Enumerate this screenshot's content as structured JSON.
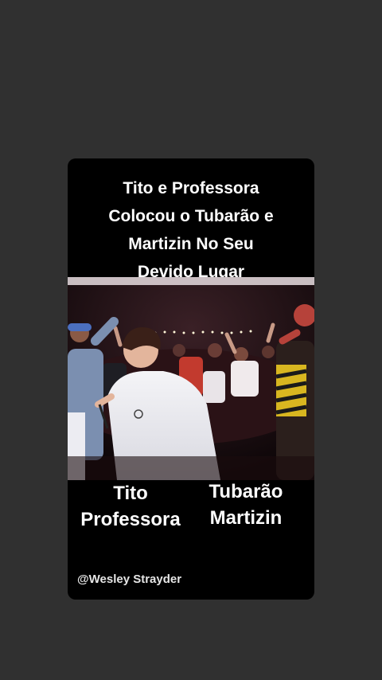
{
  "story": {
    "headline_lines": [
      "Tito e Professora",
      "Colocou o Tubarão e",
      "Martizin No Seu",
      "Devido Lugar"
    ],
    "left_names": [
      "Tito",
      "Professora"
    ],
    "right_names": [
      "Tubarão",
      "Martizin"
    ],
    "credit": "@Wesley Strayder"
  },
  "colors": {
    "page_background": "#303030",
    "card_background": "#000000",
    "text": "#ffffff"
  }
}
